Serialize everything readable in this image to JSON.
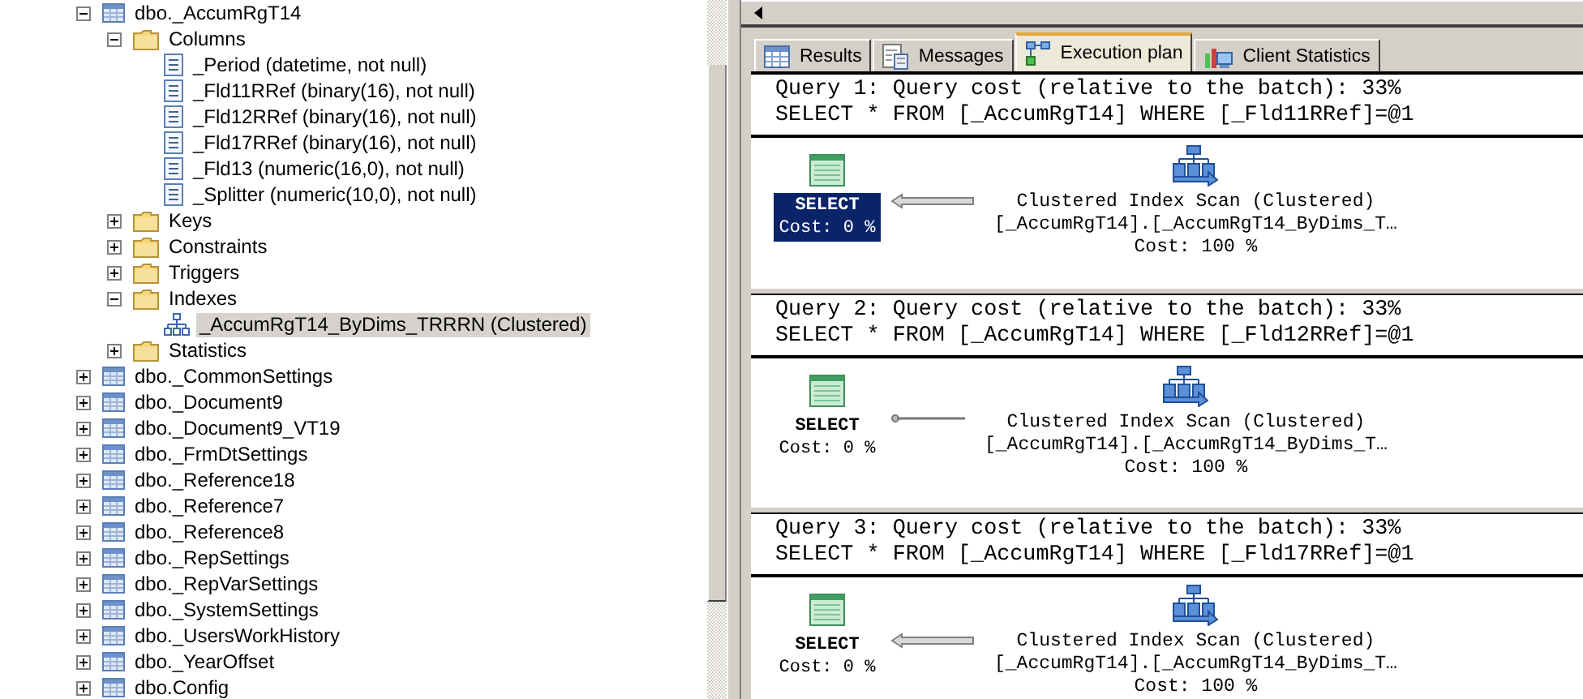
{
  "object_explorer": {
    "tree": [
      {
        "label": "dbo._AccumRgT14",
        "kind": "table",
        "expanded": true,
        "selected": false,
        "children": [
          {
            "label": "Columns",
            "kind": "folder",
            "expanded": true,
            "selected": false,
            "children": [
              {
                "label": "_Period (datetime, not null)",
                "kind": "column",
                "selected": false
              },
              {
                "label": "_Fld11RRef (binary(16), not null)",
                "kind": "column",
                "selected": false
              },
              {
                "label": "_Fld12RRef (binary(16), not null)",
                "kind": "column",
                "selected": false
              },
              {
                "label": "_Fld17RRef (binary(16), not null)",
                "kind": "column",
                "selected": false
              },
              {
                "label": "_Fld13 (numeric(16,0), not null)",
                "kind": "column",
                "selected": false
              },
              {
                "label": "_Splitter (numeric(10,0), not null)",
                "kind": "column",
                "selected": false
              }
            ]
          },
          {
            "label": "Keys",
            "kind": "folder",
            "expanded": false,
            "selected": false
          },
          {
            "label": "Constraints",
            "kind": "folder",
            "expanded": false,
            "selected": false
          },
          {
            "label": "Triggers",
            "kind": "folder",
            "expanded": false,
            "selected": false
          },
          {
            "label": "Indexes",
            "kind": "folder",
            "expanded": true,
            "selected": false,
            "children": [
              {
                "label": "_AccumRgT14_ByDims_TRRRN (Clustered)",
                "kind": "index",
                "selected": true
              }
            ]
          },
          {
            "label": "Statistics",
            "kind": "folder",
            "expanded": false,
            "selected": false
          }
        ]
      },
      {
        "label": "dbo._CommonSettings",
        "kind": "table",
        "expanded": false,
        "selected": false
      },
      {
        "label": "dbo._Document9",
        "kind": "table",
        "expanded": false,
        "selected": false
      },
      {
        "label": "dbo._Document9_VT19",
        "kind": "table",
        "expanded": false,
        "selected": false
      },
      {
        "label": "dbo._FrmDtSettings",
        "kind": "table",
        "expanded": false,
        "selected": false
      },
      {
        "label": "dbo._Reference18",
        "kind": "table",
        "expanded": false,
        "selected": false
      },
      {
        "label": "dbo._Reference7",
        "kind": "table",
        "expanded": false,
        "selected": false
      },
      {
        "label": "dbo._Reference8",
        "kind": "table",
        "expanded": false,
        "selected": false
      },
      {
        "label": "dbo._RepSettings",
        "kind": "table",
        "expanded": false,
        "selected": false
      },
      {
        "label": "dbo._RepVarSettings",
        "kind": "table",
        "expanded": false,
        "selected": false
      },
      {
        "label": "dbo._SystemSettings",
        "kind": "table",
        "expanded": false,
        "selected": false
      },
      {
        "label": "dbo._UsersWorkHistory",
        "kind": "table",
        "expanded": false,
        "selected": false
      },
      {
        "label": "dbo._YearOffset",
        "kind": "table",
        "expanded": false,
        "selected": false
      },
      {
        "label": "dbo.Config",
        "kind": "table",
        "expanded": false,
        "selected": false
      }
    ]
  },
  "result_tabs": [
    {
      "label": "Results",
      "kind": "grid",
      "selected": false
    },
    {
      "label": "Messages",
      "kind": "messages",
      "selected": false
    },
    {
      "label": "Execution plan",
      "kind": "plan",
      "selected": true
    },
    {
      "label": "Client Statistics",
      "kind": "stats",
      "selected": false
    }
  ],
  "queries": [
    {
      "header": "Query 1: Query cost (relative to the batch): 33%",
      "statement": "SELECT * FROM [_AccumRgT14] WHERE [_Fld11RRef]=@1",
      "select_label": "SELECT",
      "select_cost": "Cost: 0 %",
      "select_selected": true,
      "arrow_thick": true,
      "operator": "Clustered Index Scan (Clustered)",
      "object": "[_AccumRgT14].[_AccumRgT14_ByDims_T…",
      "operator_cost": "Cost: 100 %"
    },
    {
      "header": "Query 2: Query cost (relative to the batch): 33%",
      "statement": "SELECT * FROM [_AccumRgT14] WHERE [_Fld12RRef]=@1",
      "select_label": "SELECT",
      "select_cost": "Cost: 0 %",
      "select_selected": false,
      "arrow_thick": false,
      "operator": "Clustered Index Scan (Clustered)",
      "object": "[_AccumRgT14].[_AccumRgT14_ByDims_T…",
      "operator_cost": "Cost: 100 %"
    },
    {
      "header": "Query 3: Query cost (relative to the batch): 33%",
      "statement": "SELECT * FROM [_AccumRgT14] WHERE [_Fld17RRef]=@1",
      "select_label": "SELECT",
      "select_cost": "Cost: 0 %",
      "select_selected": false,
      "arrow_thick": true,
      "operator": "Clustered Index Scan (Clustered)",
      "object": "[_AccumRgT14].[_AccumRgT14_ByDims_T…",
      "operator_cost": "Cost: 100 %"
    }
  ]
}
